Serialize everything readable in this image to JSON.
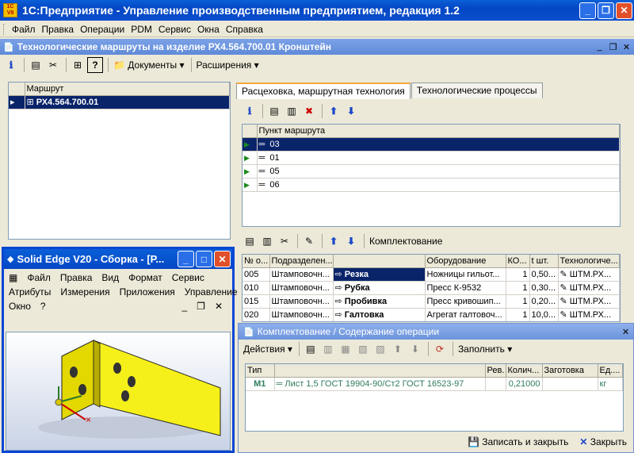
{
  "app": {
    "title": "1С:Предприятие - Управление производственным предприятием, редакция 1.2",
    "logo": "1C V8"
  },
  "menu": [
    "Файл",
    "Правка",
    "Операции",
    "PDM",
    "Сервис",
    "Окна",
    "Справка"
  ],
  "inner_window": {
    "title": "Технологические маршруты на изделие РХ4.564.700.01 Кронштейн"
  },
  "toolbar": {
    "documents": "Документы",
    "extensions": "Расширения",
    "help": "?"
  },
  "routes": {
    "header": "Маршрут",
    "items": [
      {
        "name": "РХ4.564.700.01",
        "selected": true
      }
    ]
  },
  "tabs": [
    {
      "label": "Расцеховка, маршрутная технология",
      "active": true
    },
    {
      "label": "Технологические процессы",
      "active": false
    }
  ],
  "route_points": {
    "header": "Пункт маршрута",
    "items": [
      {
        "value": "03",
        "selected": true
      },
      {
        "value": "01"
      },
      {
        "value": "05"
      },
      {
        "value": "06"
      }
    ]
  },
  "ops_toolbar": {
    "label": "Комплектование"
  },
  "operations": {
    "columns": [
      "№ о...",
      "Подразделен...",
      "",
      "Оборудование",
      "КО...",
      "t шт.",
      "Технологиче..."
    ],
    "rows": [
      {
        "num": "005",
        "dept": "Штамповочн...",
        "op": "Резка",
        "equip": "Ножницы гильот...",
        "qty": "1",
        "t": "0,50...",
        "tech": "ШТМ.РХ...",
        "selected": true
      },
      {
        "num": "010",
        "dept": "Штамповочн...",
        "op": "Рубка",
        "equip": "Пресс К-9532",
        "qty": "1",
        "t": "0,30...",
        "tech": "ШТМ.РХ..."
      },
      {
        "num": "015",
        "dept": "Штамповочн...",
        "op": "Пробивка",
        "equip": "Пресс кривошип...",
        "qty": "1",
        "t": "0,20...",
        "tech": "ШТМ.РХ..."
      },
      {
        "num": "020",
        "dept": "Штамповочн...",
        "op": "Галтовка",
        "equip": "Агрегат галтовоч...",
        "qty": "1",
        "t": "10,0...",
        "tech": "ШТМ.РХ..."
      }
    ]
  },
  "solid_edge": {
    "title": "Solid Edge V20 - Сборка - [Р...",
    "menu1": [
      "Файл",
      "Правка",
      "Вид",
      "Формат",
      "Сервис"
    ],
    "menu2": [
      "Атрибуты",
      "Измерения",
      "Приложения",
      "Управление"
    ],
    "menu3": [
      "Окно",
      "?"
    ]
  },
  "komplekt": {
    "title": "Комплектование / Содержание операции",
    "actions": "Действия",
    "fill": "Заполнить",
    "columns": [
      "Тип",
      "",
      "Рев.",
      "Колич...",
      "Заготовка",
      "Ед...."
    ],
    "rows": [
      {
        "type": "М1",
        "name": "Лист 1,5 ГОСТ 19904-90/Ст2 ГОСТ 16523-97",
        "rev": "",
        "qty": "0,21000",
        "blank": "",
        "unit": "кг"
      }
    ],
    "save_close": "Записать и закрыть",
    "close": "Закрыть"
  },
  "colors": {
    "xp_blue": "#0347c4",
    "selection": "#0a246a",
    "surface": "#ece9d8"
  }
}
